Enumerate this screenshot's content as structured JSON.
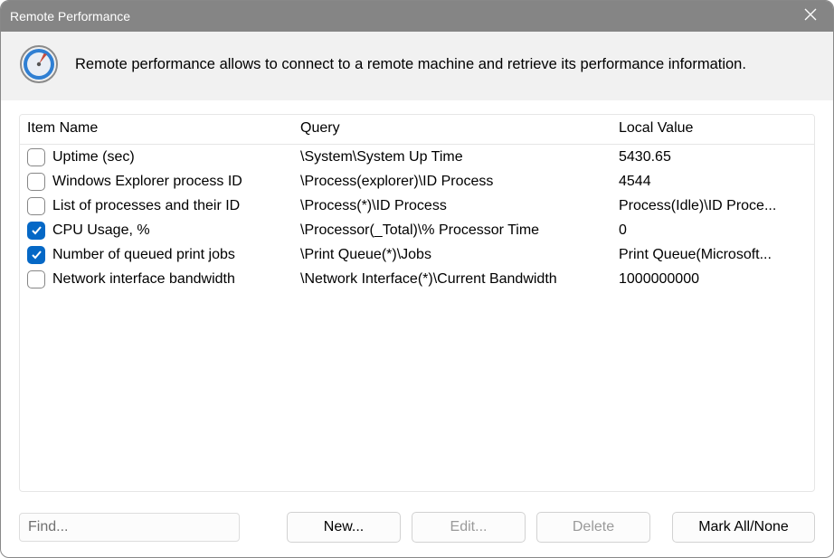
{
  "window": {
    "title": "Remote Performance"
  },
  "header": {
    "description": "Remote performance allows to connect to a remote machine and retrieve its performance information."
  },
  "table": {
    "columns": {
      "name": "Item Name",
      "query": "Query",
      "value": "Local Value"
    },
    "rows": [
      {
        "checked": false,
        "name": "Uptime (sec)",
        "query": "\\System\\System Up Time",
        "value": "5430.65"
      },
      {
        "checked": false,
        "name": "Windows Explorer process ID",
        "query": "\\Process(explorer)\\ID Process",
        "value": "4544"
      },
      {
        "checked": false,
        "name": "List of processes and their ID",
        "query": "\\Process(*)\\ID Process",
        "value": "Process(Idle)\\ID Proce..."
      },
      {
        "checked": true,
        "name": "CPU Usage, %",
        "query": "\\Processor(_Total)\\% Processor Time",
        "value": "0"
      },
      {
        "checked": true,
        "name": "Number of queued print jobs",
        "query": "\\Print Queue(*)\\Jobs",
        "value": "Print Queue(Microsoft..."
      },
      {
        "checked": false,
        "name": "Network interface bandwidth",
        "query": "\\Network Interface(*)\\Current Bandwidth",
        "value": "1000000000"
      }
    ]
  },
  "footer": {
    "find_placeholder": "Find...",
    "new_label": "New...",
    "edit_label": "Edit...",
    "delete_label": "Delete",
    "mark_label": "Mark All/None"
  }
}
